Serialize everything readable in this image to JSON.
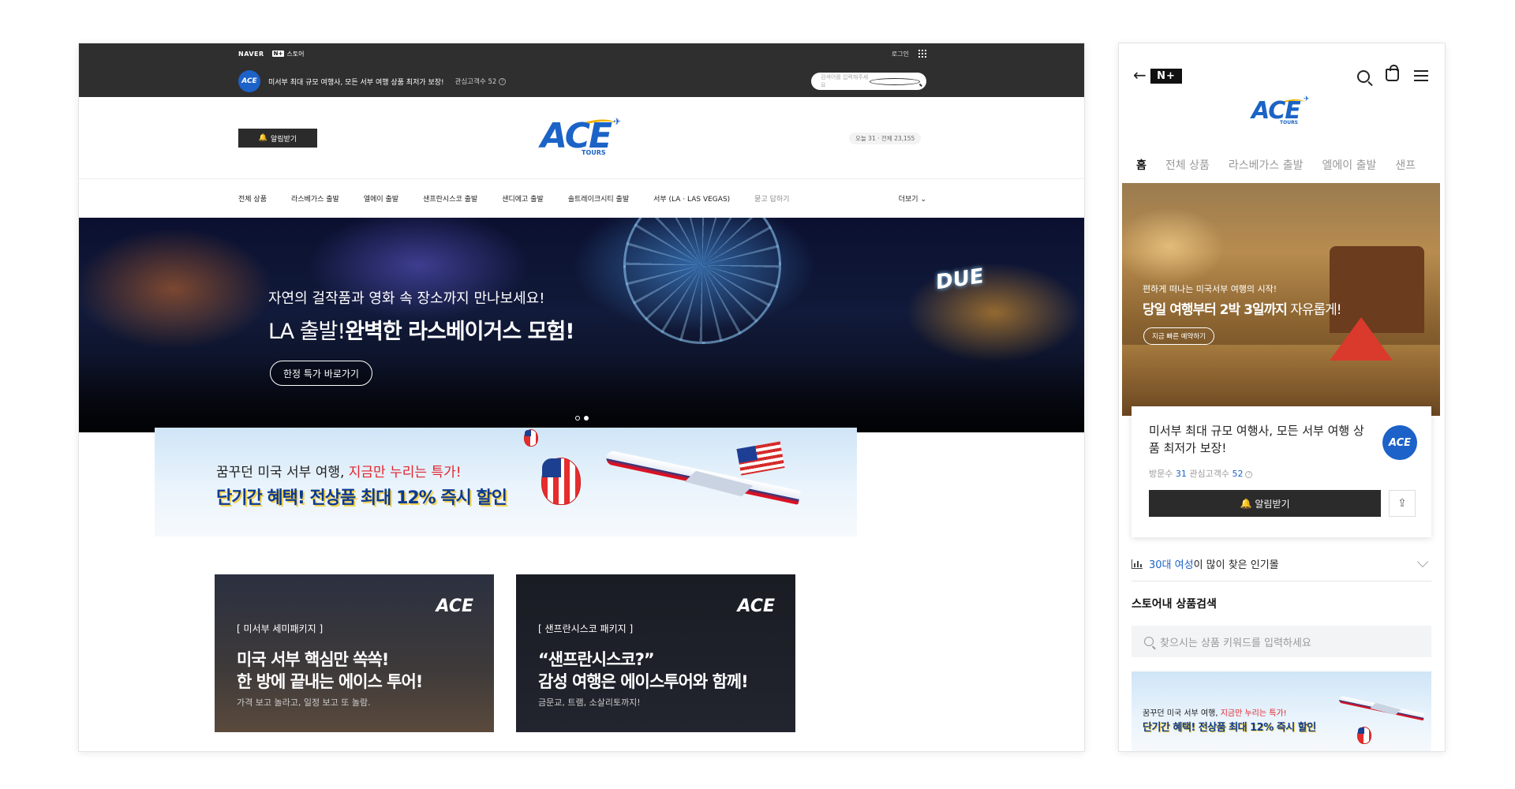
{
  "desktop": {
    "topbar": {
      "naver": "NAVER",
      "nplus_badge": "N+",
      "nplus_store": "스토어",
      "login": "로그인",
      "store_logo": "ACE",
      "tagline": "미서부 최대 규모 여행사, 모든 서부 여행 상품 최저가 보장!",
      "fans": "관심고객수 52",
      "q": "?",
      "search_placeholder": "검색어를 입력해주세요"
    },
    "header": {
      "alarm_button": "알림받기",
      "logo_ace": "ACE",
      "logo_tours": "TOURS",
      "visits": "오늘 31 · 전체 23,155"
    },
    "nav": {
      "items": [
        "전체 상품",
        "라스베가스 출발",
        "엘에이 출발",
        "샌프란시스코 출발",
        "샌디에고 출발",
        "솔트레이크시티 출발",
        "서부 (LA · LAS VEGAS)"
      ],
      "muted_item": "묻고 답하기",
      "more": "더보기 ⌄"
    },
    "hero": {
      "subtitle": "자연의 걸작품과 영화 속 장소까지 만나보세요!",
      "title_light": "LA 출발!",
      "title_bold": "완벽한 라스베이거스 모험!",
      "button": "한정 특가 바로가기",
      "sign": "DUE"
    },
    "promo": {
      "line1_a": "꿈꾸던 미국 서부 여행, ",
      "line1_b": "지금만 누리는 특가!",
      "line2": "단기간 혜택! 전상품 최대 12% 즉시 할인"
    },
    "cards": [
      {
        "logo": "ACE",
        "tag": "미서부 세미패키지",
        "title1": "미국 서부 핵심만 쏙쏙!",
        "title2": "한 방에 끝내는 에이스 투어!",
        "sub": "가격 보고 놀라고, 일정 보고 또 놀람."
      },
      {
        "logo": "ACE",
        "tag": "샌프란시스코 패키지",
        "title1": "“샌프란시스코?”",
        "title2": "감성 여행은 에이스투어와 함께!",
        "sub": "금문교, 트램, 소살리토까지!"
      }
    ]
  },
  "mobile": {
    "nplus": "N+",
    "logo_ace": "ACE",
    "logo_tours": "TOURS",
    "tabs": [
      "홈",
      "전체 상품",
      "라스베가스 출발",
      "엘에이 출발",
      "샌프"
    ],
    "hero": {
      "subtitle": "편하게 떠나는 미국서부 여행의 시작!",
      "title_bold": "당일 여행부터 2박 3일까지",
      "title_light": " 자유롭게!",
      "button": "지금 빠른 예약하기"
    },
    "store_card": {
      "description": "미서부 최대 규모 여행사, 모든 서부 여행 상품 최저가 보장!",
      "logo": "ACE",
      "visits_label": "방문수 ",
      "visits": "31",
      "fans_label": " 관심고객수 ",
      "fans": "52",
      "q": "?",
      "alarm_button": "알림받기"
    },
    "popular": {
      "age": "30대 여성",
      "rest": "이 많이 찾은 인기몰"
    },
    "search_title": "스토어내 상품검색",
    "search_placeholder": "찾으시는 상품 키워드를 입력하세요",
    "promo": {
      "line1_a": "꿈꾸던 미국 서부 여행, ",
      "line1_b": "지금만 누리는 특가!",
      "line2": "단기간 혜택! 전상품 최대 12% 즉시 할인"
    }
  },
  "colors": {
    "accent": "#1c62c8",
    "topbar": "#2f2f2f",
    "highlight": "#e2242d"
  },
  "icons": [
    "search-icon",
    "grid-menu-icon",
    "bell-icon",
    "back-arrow-icon",
    "shopping-bag-icon",
    "hamburger-menu-icon",
    "share-icon",
    "chart-icon",
    "chevron-down-icon"
  ]
}
